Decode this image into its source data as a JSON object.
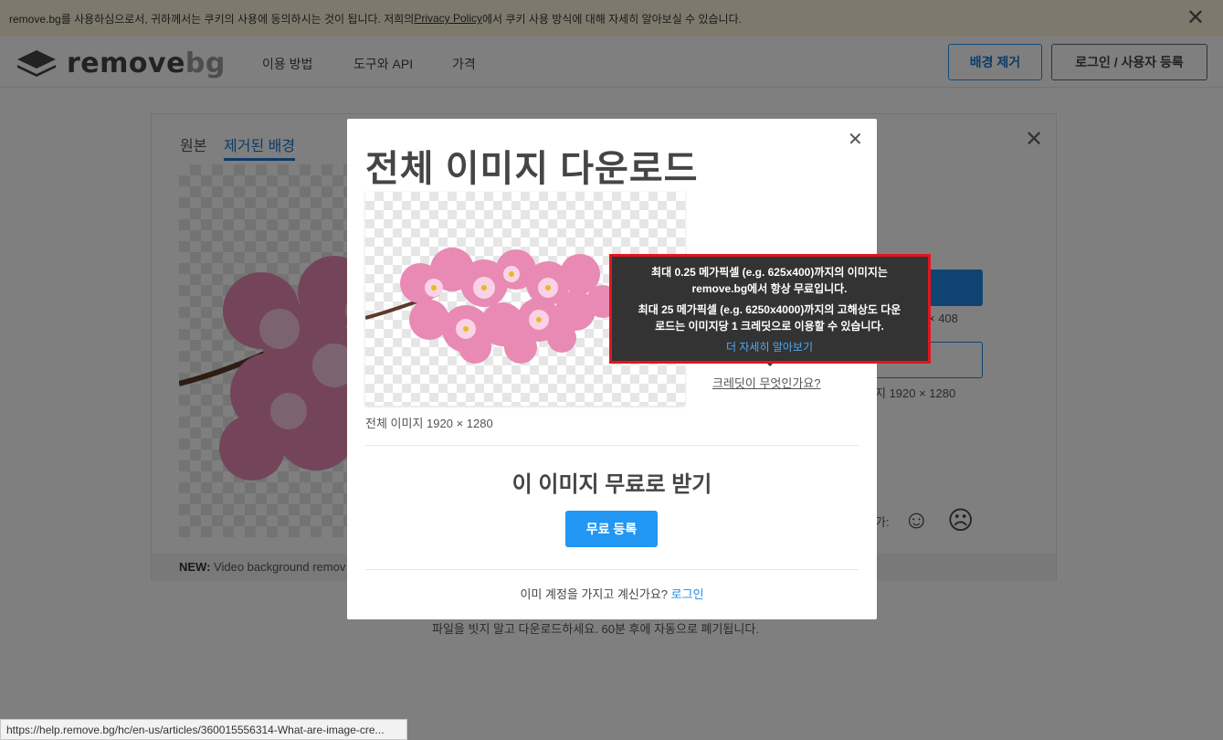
{
  "cookie": {
    "text_before": "remove.bg를 사용하심으로서, 귀하께서는 쿠키의 사용에 동의하시는 것이 됩니다. 저희의 ",
    "link": "Privacy Policy",
    "text_after": "에서 쿠키 사용 방식에 대해 자세히 알아보실 수 있습니다.",
    "close": "✕"
  },
  "header": {
    "logo_remove": "remove",
    "logo_bg": "bg",
    "nav": [
      "이용 방법",
      "도구와 API",
      "가격"
    ],
    "remove_bg_button": "배경 제거",
    "login_button": "로그인 / 사용자 등록"
  },
  "editor": {
    "tab_original": "원본",
    "tab_removed": "제거된 배경",
    "close": "✕",
    "preview_info": "× 408",
    "hd_info": "지 1920 × 1280",
    "rate_label": "가:",
    "happy_face": "☺",
    "sad_face": "☹",
    "new_label": "NEW:",
    "new_text": " Video background remov",
    "footer_note": "파일을 빗지 말고 다운로드하세요. 60분 후에 자동으로 폐기됩니다."
  },
  "modal": {
    "close": "✕",
    "title": "전체 이미지 다운로드",
    "caption": "전체 이미지 1920 × 1280",
    "credit_link": "크레딧이 무엇인가요?",
    "free_title": "이 이미지 무료로 받기",
    "signup_button": "무료 등록",
    "account_text": "이미 계정을 가지고 계신가요? ",
    "login_link": "로그인"
  },
  "tooltip": {
    "line1": "최대 0.25 메가픽셀 (e.g. 625x400)까지의 이미지는",
    "line2": "remove.bg에서 항상 무료입니다.",
    "line3": "최대 25 메가픽셀 (e.g. 6250x4000)까지의 고해상도 다운",
    "line4": "로드는 이미지당 1 크레딧으로 이용할 수 있습니다.",
    "learn_more": "더 자세히 알아보기"
  },
  "statusbar": {
    "url": "https://help.remove.bg/hc/en-us/articles/360015556314-What-are-image-cre..."
  },
  "colors": {
    "accent": "#2196f3",
    "highlight": "#e3141e",
    "tooltip_bg": "#333333",
    "cookie_bg": "#fbf4db"
  }
}
